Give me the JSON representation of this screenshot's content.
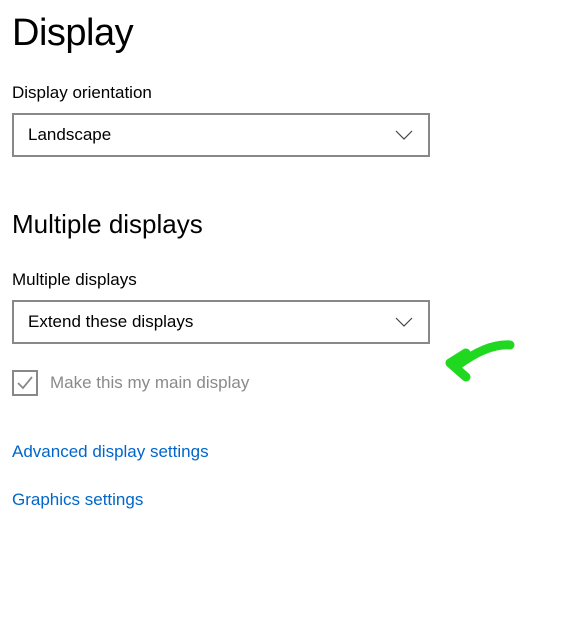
{
  "page": {
    "title": "Display"
  },
  "orientation": {
    "label": "Display orientation",
    "value": "Landscape"
  },
  "multiple_displays": {
    "heading": "Multiple displays",
    "label": "Multiple displays",
    "value": "Extend these displays"
  },
  "main_display": {
    "label": "Make this my main display"
  },
  "links": {
    "advanced": "Advanced display settings",
    "graphics": "Graphics settings"
  }
}
